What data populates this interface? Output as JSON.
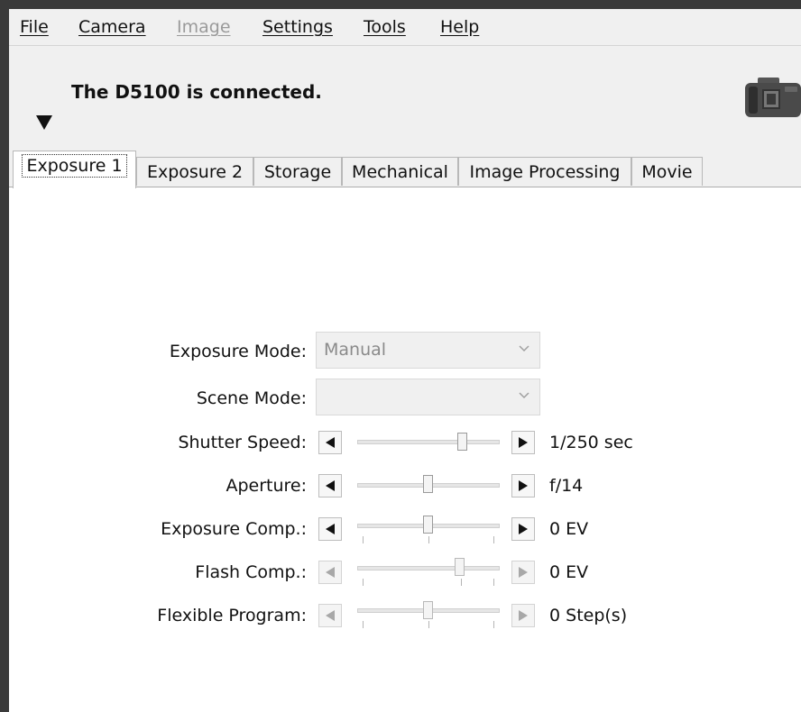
{
  "menu": {
    "file": "File",
    "camera": "Camera",
    "image": "Image",
    "settings": "Settings",
    "tools": "Tools",
    "help": "Help"
  },
  "status_text": "The D5100 is connected.",
  "icons": {
    "collapse": "triangle-down-icon",
    "camera": "camera-icon"
  },
  "tabs": [
    {
      "label": "Exposure 1",
      "active": true
    },
    {
      "label": "Exposure 2",
      "active": false
    },
    {
      "label": "Storage",
      "active": false
    },
    {
      "label": "Mechanical",
      "active": false
    },
    {
      "label": "Image Processing",
      "active": false
    },
    {
      "label": "Movie",
      "active": false
    }
  ],
  "exposure": {
    "exposure_mode": {
      "label": "Exposure Mode:",
      "value": "Manual",
      "enabled": false
    },
    "scene_mode": {
      "label": "Scene Mode:",
      "value": "",
      "enabled": false
    },
    "shutter_speed": {
      "label": "Shutter Speed:",
      "value": "1/250 sec",
      "level": 0.74,
      "enabled": true
    },
    "aperture": {
      "label": "Aperture:",
      "value": "f/14",
      "level": 0.5,
      "enabled": true
    },
    "exposure_comp": {
      "label": "Exposure Comp.:",
      "value": "0 EV",
      "level": 0.5,
      "enabled": true
    },
    "flash_comp": {
      "label": "Flash Comp.:",
      "value": "0 EV",
      "level": 0.72,
      "enabled": false
    },
    "flexible_program": {
      "label": "Flexible Program:",
      "value": "0 Step(s)",
      "level": 0.5,
      "enabled": false
    }
  },
  "colors": {
    "window_bg": "#f0f0f0",
    "panel_bg": "#ffffff",
    "disabled_text": "#9a9a9a"
  }
}
